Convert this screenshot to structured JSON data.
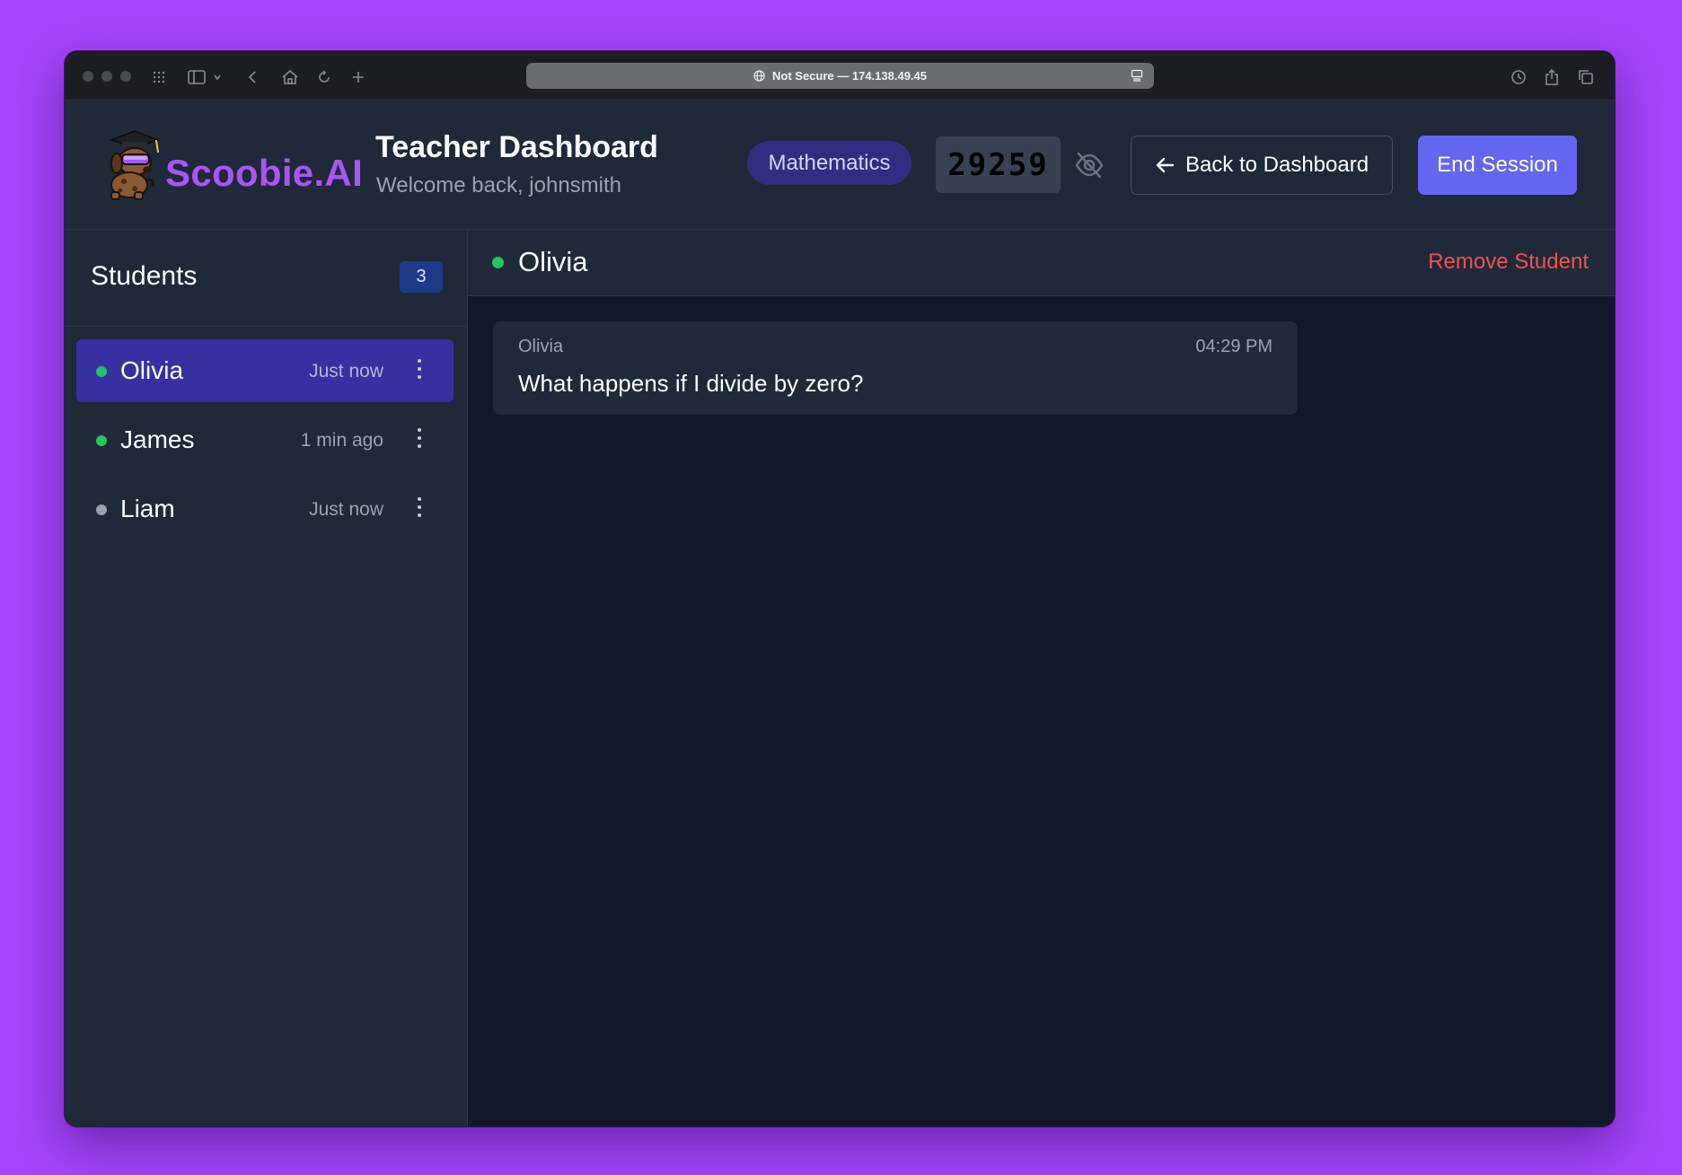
{
  "browser": {
    "address": "Not Secure — 174.138.49.45"
  },
  "header": {
    "logo_text": "Scoobie.AI",
    "title": "Teacher Dashboard",
    "subtitle": "Welcome back, johnsmith",
    "subject": "Mathematics",
    "session_code": "29259",
    "back_label": "Back to Dashboard",
    "end_label": "End Session"
  },
  "sidebar": {
    "title": "Students",
    "count": "3",
    "students": [
      {
        "name": "Olivia",
        "time": "Just now",
        "status": "online",
        "status_color": "#22c55e"
      },
      {
        "name": "James",
        "time": "1 min ago",
        "status": "online",
        "status_color": "#22c55e"
      },
      {
        "name": "Liam",
        "time": "Just now",
        "status": "offline",
        "status_color": "#9ca3af"
      }
    ]
  },
  "chat": {
    "student_name": "Olivia",
    "remove_label": "Remove Student",
    "messages": [
      {
        "sender": "Olivia",
        "time": "04:29 PM",
        "text": "What happens if I divide by zero?"
      }
    ]
  },
  "colors": {
    "accent": "#6366f1",
    "brand": "#a855f7",
    "danger": "#f05252",
    "online": "#22c55e"
  }
}
